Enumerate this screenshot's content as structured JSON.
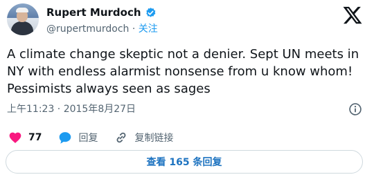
{
  "author": {
    "name": "Rupert Murdoch",
    "handle": "@rupertmurdoch",
    "separator": "·",
    "follow_label": "关注"
  },
  "tweet": {
    "text": "A climate change skeptic not a denier. Sept UN meets in NY with endless alarmist nonsense from u know whom! Pessimists always seen as sages",
    "timestamp": "上午11:23 · 2015年8月27日"
  },
  "actions": {
    "likes_count": "77",
    "reply_label": "回复",
    "copy_link_label": "复制链接"
  },
  "replies_button": {
    "label": "查看 165 条回复"
  },
  "icons": {
    "like": "heart-icon",
    "reply": "speech-bubble-icon",
    "copy": "link-icon",
    "info": "info-icon",
    "logo": "x-logo-icon",
    "verified": "verified-badge-icon"
  },
  "colors": {
    "like": "#f91880",
    "accent": "#1d9bf0",
    "link_text": "#1d73c0",
    "muted": "#536471",
    "text": "#0f1419"
  }
}
